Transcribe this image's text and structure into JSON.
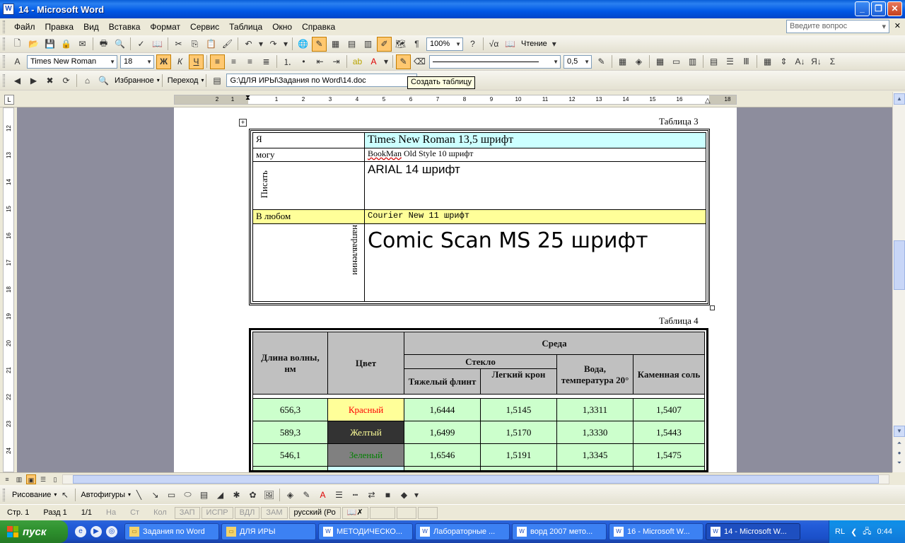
{
  "window": {
    "title": "14 - Microsoft Word",
    "icon": "W",
    "minimize": "_",
    "maximize": "❐",
    "close": "✕"
  },
  "menu": {
    "items": [
      "Файл",
      "Правка",
      "Вид",
      "Вставка",
      "Формат",
      "Сервис",
      "Таблица",
      "Окно",
      "Справка"
    ],
    "ask_placeholder": "Введите вопрос",
    "close_doc": "✕"
  },
  "toolbar_standard": {
    "zoom": "100%",
    "reading": "Чтение"
  },
  "toolbar_format": {
    "font": "Times New Roman",
    "size": "18",
    "bold": "Ж",
    "italic": "К",
    "underline": "Ч",
    "line_width": "0,5"
  },
  "toolbar_web": {
    "favorites": "Избранное",
    "goto": "Переход",
    "address": "G:\\ДЛЯ ИРЫ\\Задания по Word\\14.doc",
    "tooltip": "Создать таблицу"
  },
  "ruler": {
    "h_labels": [
      "2",
      "1",
      "1",
      "2",
      "3",
      "4",
      "5",
      "6",
      "7",
      "8",
      "9",
      "10",
      "11",
      "12",
      "13",
      "14",
      "15",
      "16",
      "18"
    ],
    "v_labels": [
      "12",
      "13",
      "14",
      "15",
      "16",
      "17",
      "18",
      "19",
      "20",
      "21",
      "22",
      "23",
      "24"
    ]
  },
  "table3": {
    "caption": "Таблица 3",
    "rows": [
      {
        "left": "Я",
        "right": "Times New Roman 13,5 шрифт"
      },
      {
        "left": "могу",
        "right_a": "BookMan",
        "right_b": " Old Style 10 шрифт"
      },
      {
        "left": "Писать",
        "right": "ARIAL 14 шрифт"
      },
      {
        "left": "В любом",
        "right": "Courier New 11 шрифт"
      },
      {
        "left": "направлении",
        "right": "Comic Scan MS 25 шрифт"
      }
    ],
    "colors": {
      "cyan": "#ccffff",
      "yellow": "#ffff99"
    }
  },
  "table4": {
    "caption": "Таблица 4",
    "headers": {
      "wavelength": "Длина волны, нм",
      "color": "Цвет",
      "medium": "Среда",
      "glass": "Стекло",
      "heavy": "Тяжелый флинт",
      "light": "Легкий крон",
      "water": "Вода, температура 20°",
      "salt": "Каменная соль"
    },
    "rows": [
      {
        "wl": "656,3",
        "color": "Красный",
        "c1": "1,6444",
        "c2": "1,5145",
        "c3": "1,3311",
        "c4": "1,5407",
        "bg": "#ffff99",
        "fg": "#ff0000"
      },
      {
        "wl": "589,3",
        "color": "Желтый",
        "c1": "1,6499",
        "c2": "1,5170",
        "c3": "1,3330",
        "c4": "1,5443",
        "bg": "#333333",
        "fg": "#ffff99"
      },
      {
        "wl": "546,1",
        "color": "Зеленый",
        "c1": "1,6546",
        "c2": "1,5191",
        "c3": "1,3345",
        "c4": "1,5475",
        "bg": "#808080",
        "fg": "#008000"
      }
    ]
  },
  "drawing": {
    "draw": "Рисование",
    "autoshapes": "Автофигуры"
  },
  "status": {
    "page": "Стр. 1",
    "section": "Разд 1",
    "pages": "1/1",
    "at": "На",
    "line": "Ст",
    "col": "Кол",
    "rec": "ЗАП",
    "trk": "ИСПР",
    "ext": "ВДЛ",
    "ovr": "ЗАМ",
    "lang": "русский (Ро"
  },
  "taskbar": {
    "start": "пуск",
    "tasks": [
      "Задания по Word",
      "ДЛЯ ИРЫ",
      "МЕТОДИЧЕСКО...",
      "Лабораторные ...",
      "ворд 2007 мето...",
      "16 - Microsoft W...",
      "14 - Microsoft W..."
    ],
    "lang": "RL",
    "time": "0:44"
  }
}
